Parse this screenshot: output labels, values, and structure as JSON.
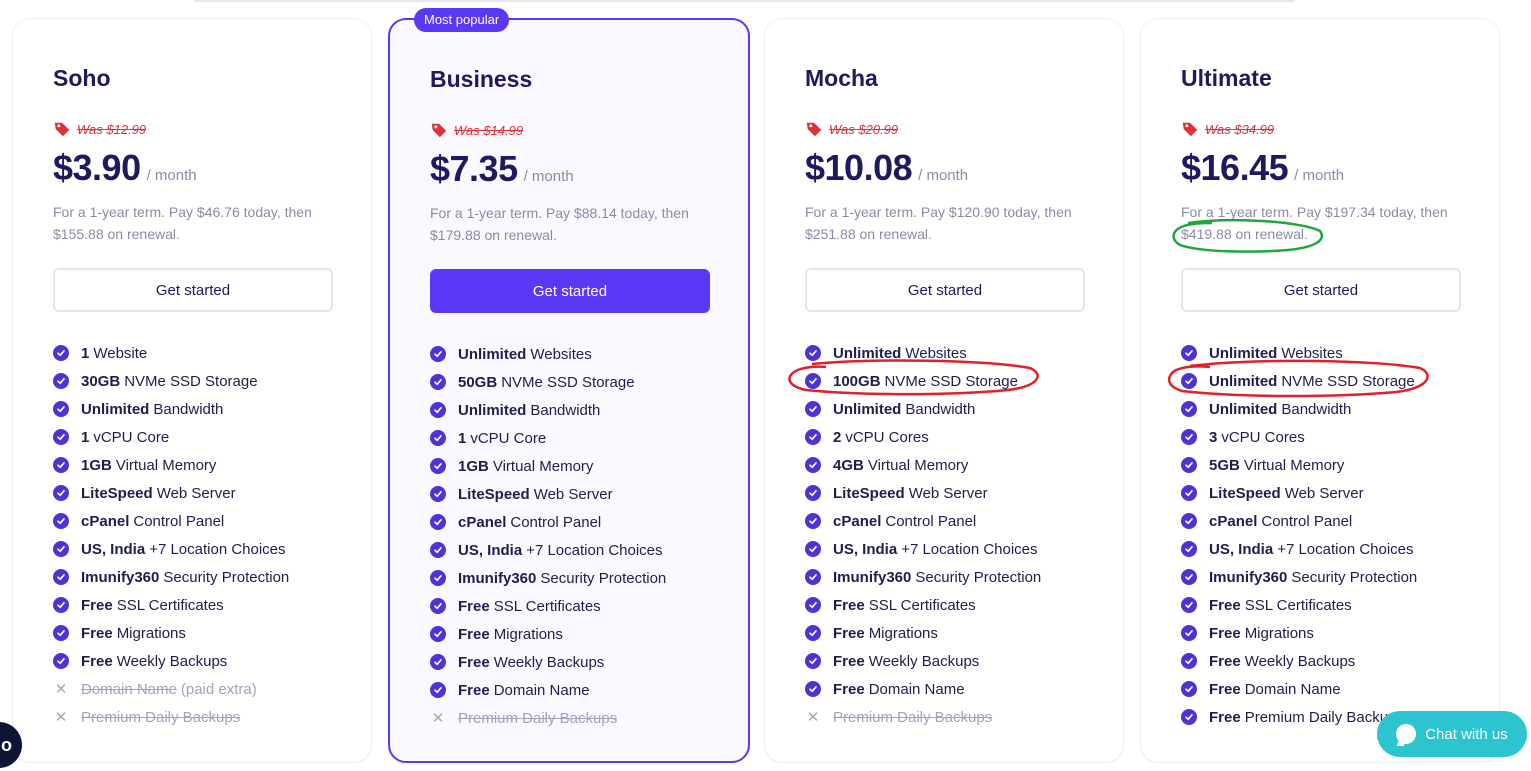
{
  "labels": {
    "get_started": "Get started",
    "per_month": "/ month",
    "most_popular": "Most popular"
  },
  "colors": {
    "accent": "#5b38f5",
    "was_price": "#e0303a",
    "chat": "#2bc4cf",
    "annotation_red": "#e0202a",
    "annotation_green": "#22a53a"
  },
  "plans": [
    {
      "name": "Soho",
      "was": "Was $12.99",
      "price": "$3.90",
      "term": "For a 1-year term. Pay $46.76 today, then $155.88 on renewal.",
      "features": [
        {
          "bold": "1",
          "text": "Website",
          "included": true
        },
        {
          "bold": "30GB",
          "text": "NVMe SSD Storage",
          "included": true
        },
        {
          "bold": "Unlimited",
          "text": "Bandwidth",
          "included": true
        },
        {
          "bold": "1",
          "text": "vCPU Core",
          "included": true
        },
        {
          "bold": "1GB",
          "text": "Virtual Memory",
          "included": true
        },
        {
          "bold": "LiteSpeed",
          "text": "Web Server",
          "included": true
        },
        {
          "bold": "cPanel",
          "text": "Control Panel",
          "included": true
        },
        {
          "bold": "US, India",
          "text": "+7 Location Choices",
          "included": true
        },
        {
          "bold": "Imunify360",
          "text": "Security Protection",
          "included": true
        },
        {
          "bold": "Free",
          "text": "SSL Certificates",
          "included": true
        },
        {
          "bold": "Free",
          "text": "Migrations",
          "included": true
        },
        {
          "bold": "Free",
          "text": "Weekly Backups",
          "included": true
        },
        {
          "bold": "",
          "text": "Domain Name",
          "suffix": "(paid extra)",
          "included": false
        },
        {
          "bold": "",
          "text": "Premium Daily Backups",
          "included": false
        }
      ]
    },
    {
      "name": "Business",
      "was": "Was $14.99",
      "price": "$7.35",
      "term": "For a 1-year term. Pay $88.14 today, then $179.88 on renewal.",
      "features": [
        {
          "bold": "Unlimited",
          "text": "Websites",
          "included": true
        },
        {
          "bold": "50GB",
          "text": "NVMe SSD Storage",
          "included": true
        },
        {
          "bold": "Unlimited",
          "text": "Bandwidth",
          "included": true
        },
        {
          "bold": "1",
          "text": "vCPU Core",
          "included": true
        },
        {
          "bold": "1GB",
          "text": "Virtual Memory",
          "included": true
        },
        {
          "bold": "LiteSpeed",
          "text": "Web Server",
          "included": true
        },
        {
          "bold": "cPanel",
          "text": "Control Panel",
          "included": true
        },
        {
          "bold": "US, India",
          "text": "+7 Location Choices",
          "included": true
        },
        {
          "bold": "Imunify360",
          "text": "Security Protection",
          "included": true
        },
        {
          "bold": "Free",
          "text": "SSL Certificates",
          "included": true
        },
        {
          "bold": "Free",
          "text": "Migrations",
          "included": true
        },
        {
          "bold": "Free",
          "text": "Weekly Backups",
          "included": true
        },
        {
          "bold": "Free",
          "text": "Domain Name",
          "included": true
        },
        {
          "bold": "",
          "text": "Premium Daily Backups",
          "included": false
        }
      ]
    },
    {
      "name": "Mocha",
      "was": "Was $20.99",
      "price": "$10.08",
      "term": "For a 1-year term. Pay $120.90 today, then $251.88 on renewal.",
      "features": [
        {
          "bold": "Unlimited",
          "text": "Websites",
          "included": true
        },
        {
          "bold": "100GB",
          "text": "NVMe SSD Storage",
          "included": true
        },
        {
          "bold": "Unlimited",
          "text": "Bandwidth",
          "included": true
        },
        {
          "bold": "2",
          "text": "vCPU Cores",
          "included": true
        },
        {
          "bold": "4GB",
          "text": "Virtual Memory",
          "included": true
        },
        {
          "bold": "LiteSpeed",
          "text": "Web Server",
          "included": true
        },
        {
          "bold": "cPanel",
          "text": "Control Panel",
          "included": true
        },
        {
          "bold": "US, India",
          "text": "+7 Location Choices",
          "included": true
        },
        {
          "bold": "Imunify360",
          "text": "Security Protection",
          "included": true
        },
        {
          "bold": "Free",
          "text": "SSL Certificates",
          "included": true
        },
        {
          "bold": "Free",
          "text": "Migrations",
          "included": true
        },
        {
          "bold": "Free",
          "text": "Weekly Backups",
          "included": true
        },
        {
          "bold": "Free",
          "text": "Domain Name",
          "included": true
        },
        {
          "bold": "",
          "text": "Premium Daily Backups",
          "included": false
        }
      ]
    },
    {
      "name": "Ultimate",
      "was": "Was $34.99",
      "price": "$16.45",
      "term": "For a 1-year term. Pay $197.34 today, then $419.88 on renewal.",
      "features": [
        {
          "bold": "Unlimited",
          "text": "Websites",
          "included": true
        },
        {
          "bold": "Unlimited",
          "text": "NVMe SSD Storage",
          "included": true
        },
        {
          "bold": "Unlimited",
          "text": "Bandwidth",
          "included": true
        },
        {
          "bold": "3",
          "text": "vCPU Cores",
          "included": true
        },
        {
          "bold": "5GB",
          "text": "Virtual Memory",
          "included": true
        },
        {
          "bold": "LiteSpeed",
          "text": "Web Server",
          "included": true
        },
        {
          "bold": "cPanel",
          "text": "Control Panel",
          "included": true
        },
        {
          "bold": "US, India",
          "text": "+7 Location Choices",
          "included": true
        },
        {
          "bold": "Imunify360",
          "text": "Security Protection",
          "included": true
        },
        {
          "bold": "Free",
          "text": "SSL Certificates",
          "included": true
        },
        {
          "bold": "Free",
          "text": "Migrations",
          "included": true
        },
        {
          "bold": "Free",
          "text": "Weekly Backups",
          "included": true
        },
        {
          "bold": "Free",
          "text": "Domain Name",
          "included": true
        },
        {
          "bold": "Free",
          "text": "Premium Daily Backu",
          "included": true
        }
      ]
    }
  ],
  "chat": {
    "label": "Chat with us"
  },
  "corner_widget": {
    "label": "o"
  }
}
